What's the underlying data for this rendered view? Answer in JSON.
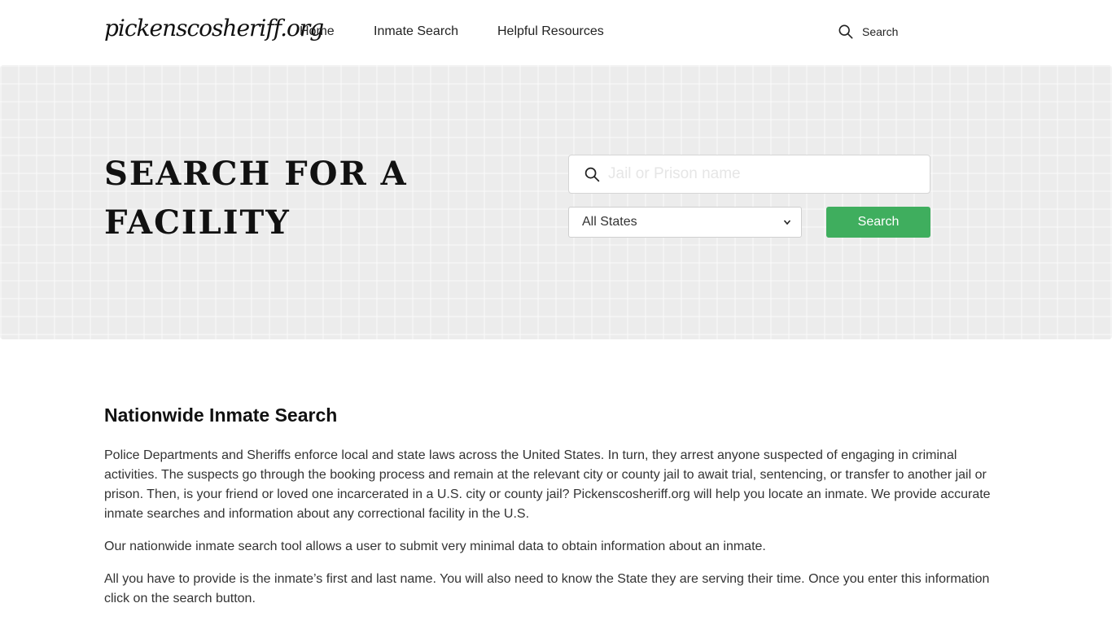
{
  "header": {
    "logo": "pickenscosheriff.org",
    "nav": [
      {
        "label": "Home"
      },
      {
        "label": "Inmate Search"
      },
      {
        "label": "Helpful Resources"
      }
    ],
    "search_label": "Search"
  },
  "hero": {
    "title": "SEARCH FOR A FACILITY",
    "search_placeholder": "Jail or Prison name",
    "state_select_value": "All States",
    "search_button": "Search"
  },
  "content": {
    "heading": "Nationwide Inmate Search",
    "paragraphs": [
      "Police Departments and Sheriffs enforce local and state laws across the United States. In turn, they arrest anyone suspected of engaging in criminal activities. The suspects go through the booking process and remain at the relevant city or county jail to await trial, sentencing, or transfer to another jail or prison. Then, is your friend or loved one incarcerated in a U.S. city or county jail? Pickenscosheriff.org will help you locate an inmate. We provide accurate inmate searches and information about any correctional facility in the U.S.",
      "Our nationwide inmate search tool allows a user to submit very minimal data to obtain information about an inmate.",
      "All you have to provide is the inmate’s first and last name. You will also need to know the State they are serving their time. Once you enter this information click on the search button."
    ]
  },
  "colors": {
    "accent_green": "#3fae5e",
    "hero_bg": "#ececec"
  },
  "icons": {
    "search": "search-icon",
    "dropdown": "chevron-down-icon"
  }
}
